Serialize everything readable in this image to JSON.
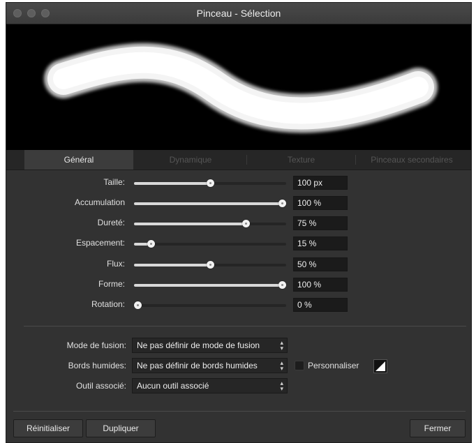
{
  "window": {
    "title": "Pinceau - Sélection"
  },
  "tabs": [
    {
      "label": "Général",
      "active": true
    },
    {
      "label": "Dynamique",
      "active": false
    },
    {
      "label": "Texture",
      "active": false
    },
    {
      "label": "Pinceaux secondaires",
      "active": false
    }
  ],
  "sliders": [
    {
      "label": "Taille:",
      "value": "100 px",
      "fraction": 0.5
    },
    {
      "label": "Accumulation",
      "value": "100 %",
      "fraction": 1.0
    },
    {
      "label": "Dureté:",
      "value": "75 %",
      "fraction": 0.75
    },
    {
      "label": "Espacement:",
      "value": "15 %",
      "fraction": 0.09
    },
    {
      "label": "Flux:",
      "value": "50 %",
      "fraction": 0.5
    },
    {
      "label": "Forme:",
      "value": "100 %",
      "fraction": 1.0
    },
    {
      "label": "Rotation:",
      "value": "0 %",
      "fraction": 0.0
    }
  ],
  "options": {
    "blend_mode": {
      "label": "Mode de fusion:",
      "value": "Ne pas définir de mode de fusion"
    },
    "wet_edges": {
      "label": "Bords humides:",
      "value": "Ne pas définir de bords humides"
    },
    "custom_label": "Personnaliser",
    "associated_tool": {
      "label": "Outil associé:",
      "value": "Aucun outil associé"
    }
  },
  "buttons": {
    "reset": "Réinitialiser",
    "duplicate": "Dupliquer",
    "close": "Fermer"
  },
  "colors": {
    "window_bg": "#323232",
    "preview_bg": "#000000",
    "stroke": "#ffffff"
  }
}
